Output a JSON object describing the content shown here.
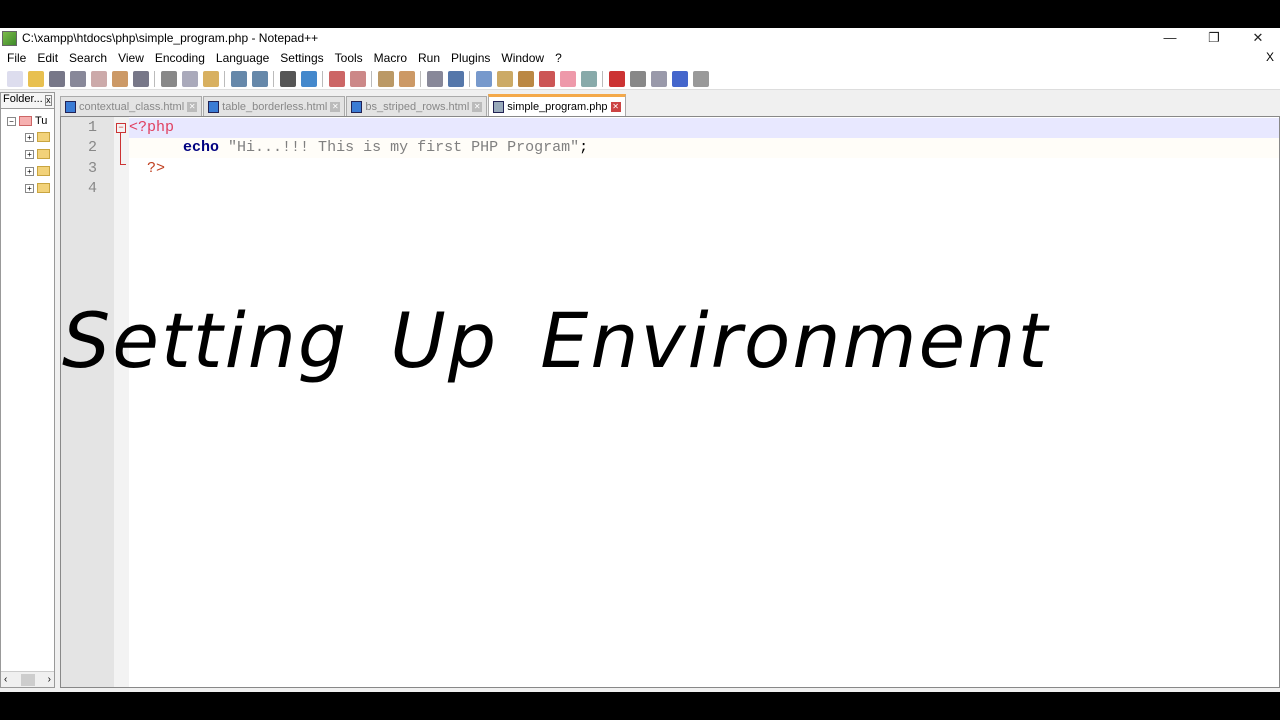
{
  "window": {
    "title": "C:\\xampp\\htdocs\\php\\simple_program.php - Notepad++",
    "minimize": "—",
    "restore": "❐",
    "close": "✕"
  },
  "menu": {
    "items": [
      "File",
      "Edit",
      "Search",
      "View",
      "Encoding",
      "Language",
      "Settings",
      "Tools",
      "Macro",
      "Run",
      "Plugins",
      "Window",
      "?"
    ],
    "close_doc": "X"
  },
  "toolbar": {
    "icons": [
      "new-file",
      "open-file",
      "save",
      "save-all",
      "close",
      "close-all",
      "print",
      "|",
      "cut",
      "copy",
      "paste",
      "|",
      "undo",
      "redo",
      "|",
      "find",
      "replace",
      "|",
      "zoom-in",
      "zoom-out",
      "|",
      "sync-vertical",
      "sync-horizontal",
      "|",
      "word-wrap",
      "show-all-chars",
      "|",
      "indent-guide",
      "doc-map",
      "function-list",
      "folder-as-workspace",
      "document-list",
      "monitor",
      "|",
      "record-macro",
      "stop-record",
      "play-macro",
      "run-macro-multiple",
      "save-macro"
    ]
  },
  "folder_panel": {
    "title": "Folder...",
    "close": "x",
    "root": "Tu"
  },
  "tabs": [
    {
      "label": "contextual_class.html",
      "active": false
    },
    {
      "label": "table_borderless.html",
      "active": false
    },
    {
      "label": "bs_striped_rows.html",
      "active": false
    },
    {
      "label": "simple_program.php",
      "active": true
    }
  ],
  "editor": {
    "line_numbers": [
      "1",
      "2",
      "3",
      "4"
    ],
    "lines": {
      "l1": "<?php",
      "l2_kw": "echo",
      "l2_str": "\"Hi...!!! This is my first PHP Program\"",
      "l2_end": ";",
      "l3": "?>"
    }
  },
  "overlay_title": "Setting Up Environment"
}
